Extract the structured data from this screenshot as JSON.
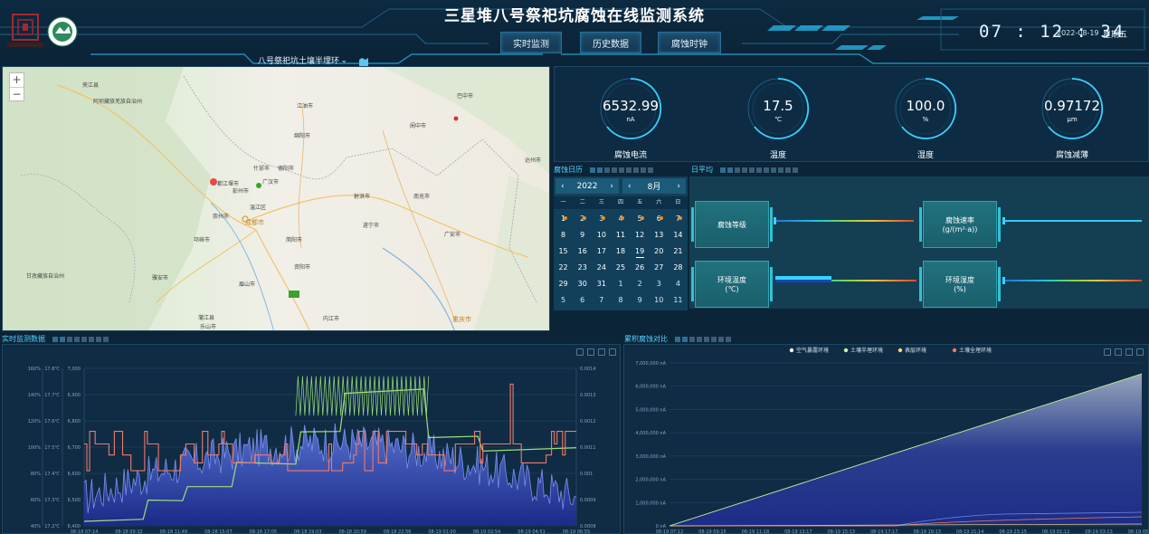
{
  "header": {
    "title": "三星堆八号祭祀坑腐蚀在线监测系统",
    "nav": [
      "实时监测",
      "历史数据",
      "腐蚀时钟"
    ],
    "clock": "07 : 12 : 34",
    "date": "2022-08-19",
    "weekday": "星期五",
    "selector": "八号祭祀坑土壤半埋环",
    "logo_text": "三星堆博物馆"
  },
  "map": {
    "zoom_in": "+",
    "zoom_out": "−",
    "cities": [
      "巴中市",
      "阿坝藏族羌族自治州",
      "江油市",
      "绵阳市",
      "德阳市",
      "什邡市",
      "广汉市",
      "彭州市",
      "都江堰市",
      "成都市",
      "崇州市",
      "温江区",
      "简阳市",
      "资阳市",
      "眉山市",
      "雅安市",
      "甘孜藏族自治州",
      "遂宁市",
      "南充市",
      "射洪市",
      "广安市",
      "内江市",
      "重庆市",
      "乐山市",
      "达州市",
      "阆中市",
      "邛崃市",
      "蒲江县",
      "夹江县"
    ]
  },
  "gauges": [
    {
      "value": "6532.99",
      "unit": "nA",
      "label": "腐蚀电流"
    },
    {
      "value": "17.5",
      "unit": "℃",
      "label": "温度"
    },
    {
      "value": "100.0",
      "unit": "%",
      "label": "湿度"
    },
    {
      "value": "0.97172",
      "unit": "μm",
      "label": "腐蚀减薄"
    }
  ],
  "calendar": {
    "title": "腐蚀日历",
    "year": "2022",
    "month": "8月",
    "weekdays": [
      "一",
      "二",
      "三",
      "四",
      "五",
      "六",
      "日"
    ],
    "rows": [
      [
        "1",
        "2",
        "3",
        "4",
        "5",
        "6",
        "7"
      ],
      [
        "8",
        "9",
        "10",
        "11",
        "12",
        "13",
        "14"
      ],
      [
        "15",
        "16",
        "17",
        "18",
        "19",
        "20",
        "21"
      ],
      [
        "22",
        "23",
        "24",
        "25",
        "26",
        "27",
        "28"
      ],
      [
        "29",
        "30",
        "31",
        "1",
        "2",
        "3",
        "4"
      ],
      [
        "5",
        "6",
        "7",
        "8",
        "9",
        "10",
        "11"
      ]
    ]
  },
  "indicator": {
    "title": "日平均",
    "boxes": [
      {
        "line1": "腐蚀等级",
        "line2": ""
      },
      {
        "line1": "腐蚀速率",
        "line2": "(g/(m²·a))"
      },
      {
        "line1": "环境温度",
        "line2": "(℃)"
      },
      {
        "line1": "环境湿度",
        "line2": "(%)"
      }
    ]
  },
  "realtime": {
    "title": "实时监测数据",
    "axis_pct": [
      "160%",
      "140%",
      "120%",
      "100%",
      "80%",
      "60%",
      "40%"
    ],
    "axis_temp": [
      "17.8℃",
      "17.7℃",
      "17.6℃",
      "17.5℃",
      "17.4℃",
      "17.3℃",
      "17.2℃",
      "17.1℃"
    ],
    "axis_current": [
      "7,000",
      "6,900",
      "6,800",
      "6,700",
      "6,600",
      "6,500",
      "6,400"
    ],
    "axis_right": [
      "0.0014",
      "0.0013",
      "0.0012",
      "0.0011",
      "0.001",
      "0.0009",
      "0.0008"
    ],
    "x_labels": [
      "08-18 07:14",
      "08-18 09:32",
      "08-18 11:49",
      "08-18 15:07",
      "08-18 17:05",
      "08-18 19:03",
      "08-18 20:59",
      "08-18 22:56",
      "08-19 01:00",
      "08-19 02:54",
      "08-19 04:51",
      "08-19 06:55"
    ]
  },
  "cumulative": {
    "title": "累积腐蚀对比",
    "legend": [
      "空气暴露环境",
      "土壤半埋环境",
      "表层环境",
      "土壤全埋环境"
    ],
    "y_labels": [
      "7,000,000 nA",
      "6,000,000 nA",
      "5,000,000 nA",
      "4,000,000 nA",
      "3,000,000 nA",
      "2,000,000 nA",
      "1,000,000 nA",
      "0 nA"
    ],
    "x_labels": [
      "08-19 07:12",
      "08-19 09:15",
      "08-19 11:18",
      "08-19 13:17",
      "08-19 15:13",
      "08-19 17:17",
      "08-19 19:13",
      "08-19 21:14",
      "08-19 23:15",
      "08-19 01:12",
      "08-19 03:13",
      "08-19 05:14"
    ]
  },
  "colors": {
    "accent": "#37c8ff",
    "panel": "#0f2c44",
    "red_series": "#f07a6a",
    "green_series": "#9ee07a",
    "blue_series": "#5b74d6"
  }
}
